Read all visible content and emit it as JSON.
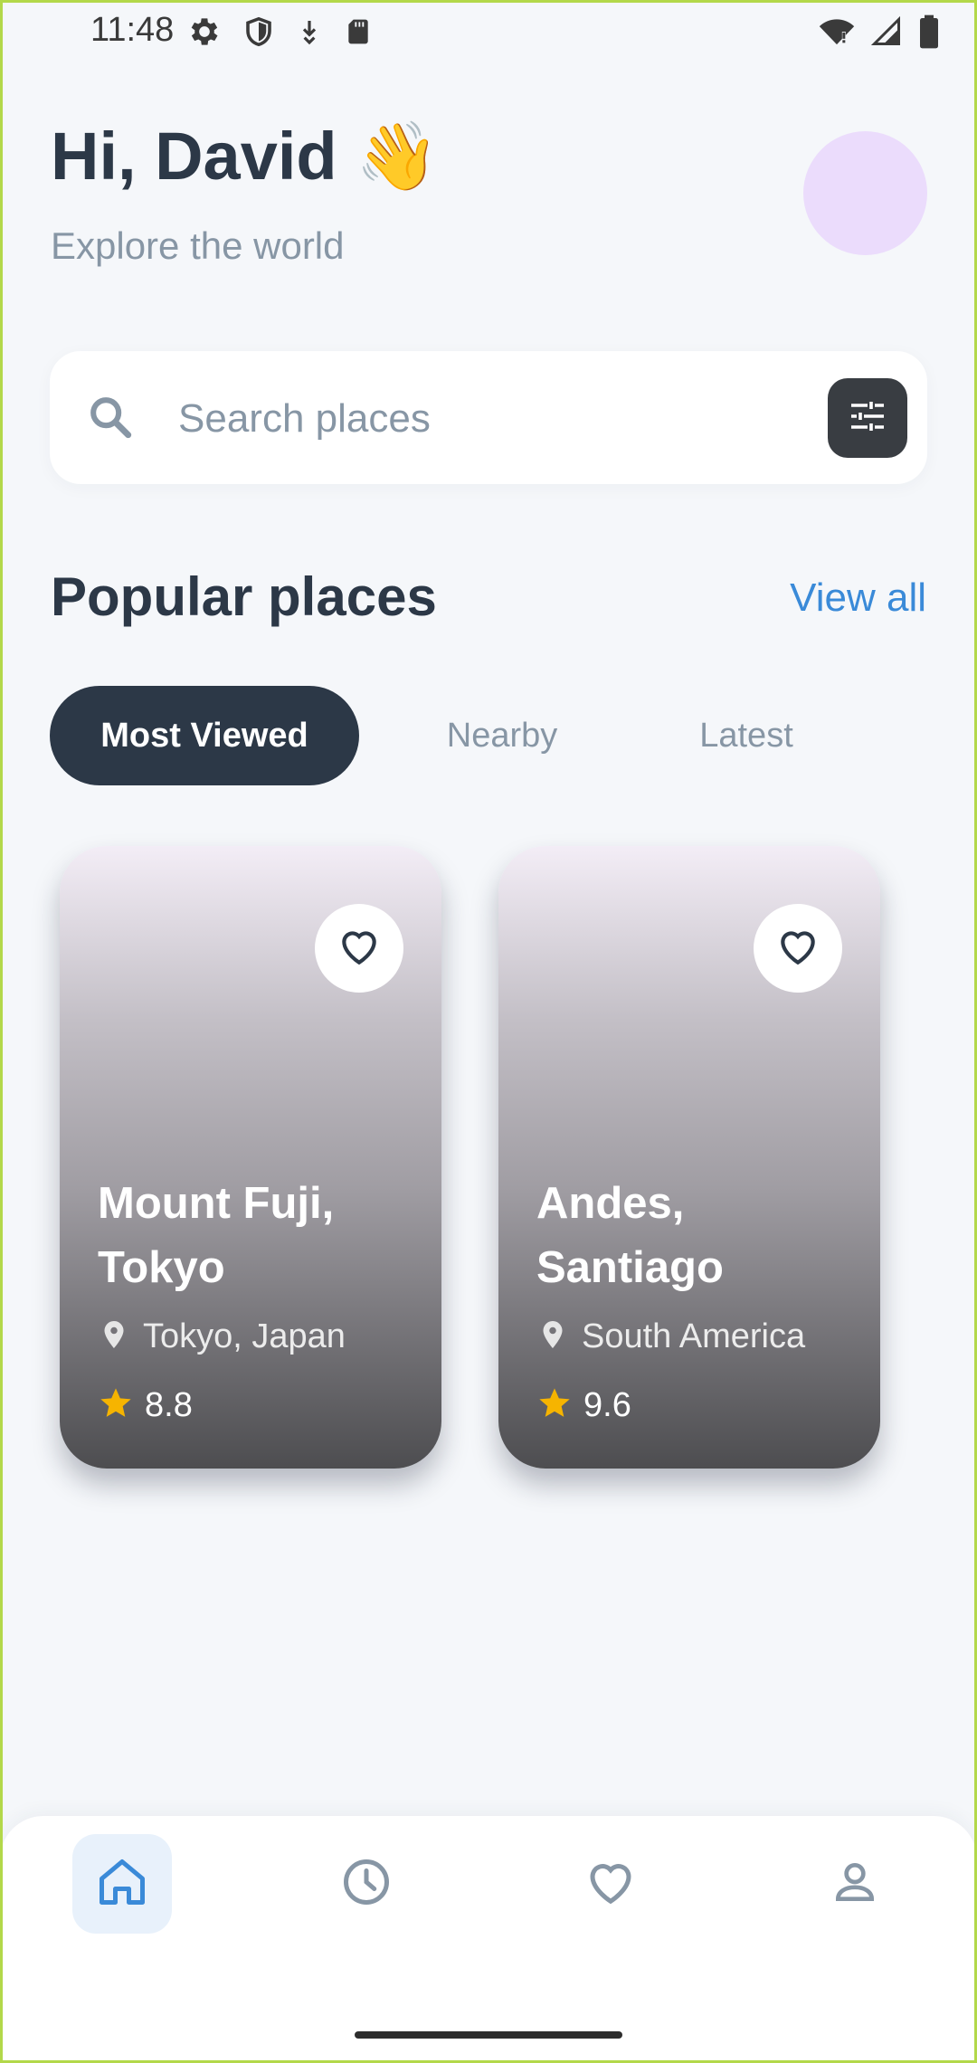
{
  "status_bar": {
    "time": "11:48",
    "left_icons": [
      "gear-icon",
      "shield-icon",
      "download-icon",
      "sd-card-icon"
    ],
    "right_icons": [
      "wifi-icon",
      "signal-icon",
      "battery-icon"
    ]
  },
  "header": {
    "greeting": "Hi, David 👋",
    "subtitle": "Explore the world",
    "avatar_color": "#ebdcfc"
  },
  "search": {
    "placeholder": "Search places",
    "value": ""
  },
  "section": {
    "title": "Popular places",
    "view_all": "View all"
  },
  "tabs": [
    {
      "label": "Most Viewed",
      "active": true
    },
    {
      "label": "Nearby",
      "active": false
    },
    {
      "label": "Latest",
      "active": false
    }
  ],
  "places": [
    {
      "title": "Mount Fuji, Tokyo",
      "location": "Tokyo, Japan",
      "rating": "8.8"
    },
    {
      "title": "Andes, Santiago",
      "location": "South America",
      "rating": "9.6"
    }
  ],
  "bottom_nav": [
    {
      "icon": "home-icon",
      "active": true
    },
    {
      "icon": "clock-icon",
      "active": false
    },
    {
      "icon": "heart-icon",
      "active": false
    },
    {
      "icon": "profile-icon",
      "active": false
    }
  ],
  "colors": {
    "background": "#f5f7fa",
    "primary_dark": "#2c3847",
    "accent_blue": "#3a8ad8",
    "muted_text": "#8796a5",
    "star": "#f6b400"
  }
}
